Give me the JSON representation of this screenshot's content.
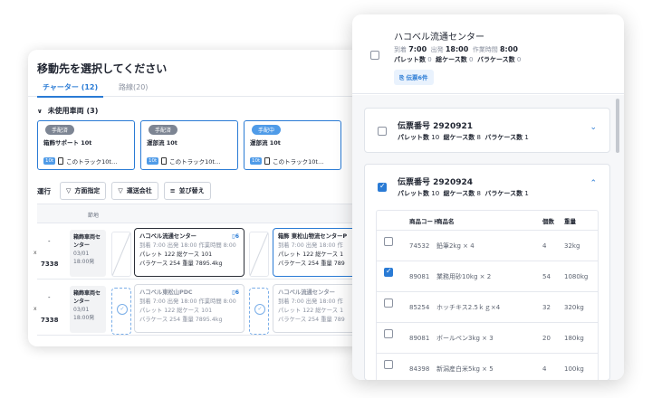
{
  "back": {
    "title": "移動先を選択してください",
    "tabs": [
      {
        "label": "チャーター (12)"
      },
      {
        "label": "路線(20)"
      }
    ],
    "unused_label": "未使用車両 (3)",
    "vehicles": [
      {
        "badge": "手配済",
        "name": "箱飾サポート 10t",
        "ton": "10t",
        "desc": "このトラック10t…"
      },
      {
        "badge": "手配済",
        "name": "運部流 10t",
        "ton": "10t",
        "desc": "このトラック10t…"
      },
      {
        "badge": "手配中",
        "name": "運部流 10t",
        "ton": "10t",
        "desc": "このトラック10t…"
      }
    ],
    "op_label": "運行",
    "filters": [
      {
        "label": "方面指定"
      },
      {
        "label": "運送会社"
      },
      {
        "label": "並び替え"
      }
    ],
    "grid_head": "節地",
    "rows": [
      {
        "left": "-",
        "x": "x",
        "num": "7338",
        "center_name": "箱飾車両センター",
        "center_date": "03/01",
        "center_time": "18:00発",
        "trip1": {
          "name": "ハコベル流通センター",
          "count": "6",
          "line1": "到着 7:00  出発 18:00  作業時間 8:00",
          "line2": "パレット 122  総ケース 101",
          "line3": "バラケース 254  重量 7895.4kg"
        },
        "trip2": {
          "name": "箱飾 東松山物流センターP",
          "line1": "到着 7:00  出発 18:00  作",
          "line2": "パレット 122  総ケース 1",
          "line3": "バラケース 254  重量 789"
        }
      },
      {
        "left": "-",
        "x": "x",
        "num": "7338",
        "center_name": "箱飾車両センター",
        "center_date": "03/01",
        "center_time": "18:00発",
        "trip1": {
          "name": "ハコベル東松山PDC",
          "count": "6",
          "line1": "到着 7:00  出発 18:00  作業時間 8:00",
          "line2": "パレット 122  総ケース 101",
          "line3": "バラケース 254  重量 7895.4kg"
        },
        "trip2": {
          "name": "ハコベル流通センター",
          "line1": "到着 7:00  出発 18:00  作",
          "line2": "パレット 122  総ケース 1",
          "line3": "バラケース 254  重量 789"
        }
      }
    ]
  },
  "panel": {
    "title": "ハコベル流通センター",
    "arrive_label": "到着",
    "arrive": "7:00",
    "depart_label": "出発",
    "depart": "18:00",
    "work_label": "作業時間",
    "work": "8:00",
    "pallet_label": "パレット数",
    "pallet": "0",
    "cases_label": "総ケース数",
    "cases": "0",
    "loose_label": "バラケース数",
    "loose": "0",
    "chip": "伝票6件",
    "slips": [
      {
        "no_label": "伝票番号",
        "no": "2920921",
        "pallet": "10",
        "cases": "8",
        "loose": "1",
        "checked": false
      },
      {
        "no_label": "伝票番号",
        "no": "2920924",
        "pallet": "10",
        "cases": "8",
        "loose": "1",
        "checked": true
      }
    ],
    "meta_labels": {
      "pallet": "パレット数",
      "cases": "総ケース数",
      "loose": "バラケース数"
    },
    "table": {
      "headers": [
        "商品コード",
        "商品名",
        "個数",
        "重量"
      ],
      "rows": [
        {
          "code": "74532",
          "name": "鉛筆2kg × 4",
          "qty": "4",
          "weight": "32kg",
          "checked": false
        },
        {
          "code": "89081",
          "name": "業務用砂10kg × 2",
          "qty": "54",
          "weight": "1080kg",
          "checked": true
        },
        {
          "code": "85254",
          "name": "ホッチキス2.5ｋｇ×4",
          "qty": "32",
          "weight": "320kg",
          "checked": false
        },
        {
          "code": "89081",
          "name": "ボールペン3kg × 3",
          "qty": "20",
          "weight": "180kg",
          "checked": false
        },
        {
          "code": "84398",
          "name": "新潟産白米5kg × 5",
          "qty": "4",
          "weight": "100kg",
          "checked": false
        }
      ]
    }
  }
}
